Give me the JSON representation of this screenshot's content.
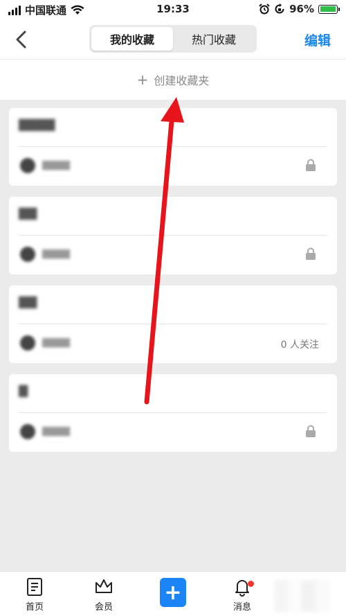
{
  "status_bar": {
    "carrier": "中国联通",
    "time": "19:33",
    "battery": "96%",
    "battery_level": 0.96
  },
  "header": {
    "tabs": [
      {
        "label": "我的收藏",
        "active": true
      },
      {
        "label": "热门收藏",
        "active": false
      }
    ],
    "edit_label": "编辑"
  },
  "create": {
    "label": "创建收藏夹"
  },
  "cards": [
    {
      "meta": "lock-icon"
    },
    {
      "meta": "lock-icon"
    },
    {
      "meta": "follow",
      "follow_text": "0 人关注"
    },
    {
      "meta": "lock-icon"
    }
  ],
  "tabbar": {
    "items": [
      {
        "label": "首页",
        "icon": "home-icon"
      },
      {
        "label": "会员",
        "icon": "crown-icon"
      },
      {
        "label": "",
        "icon": "plus-icon"
      },
      {
        "label": "消息",
        "icon": "bell-icon"
      }
    ]
  },
  "colors": {
    "accent": "#1e88e5",
    "add_button": "#1b85f7",
    "badge": "#f2362f",
    "annotation_arrow": "#e8141b"
  }
}
